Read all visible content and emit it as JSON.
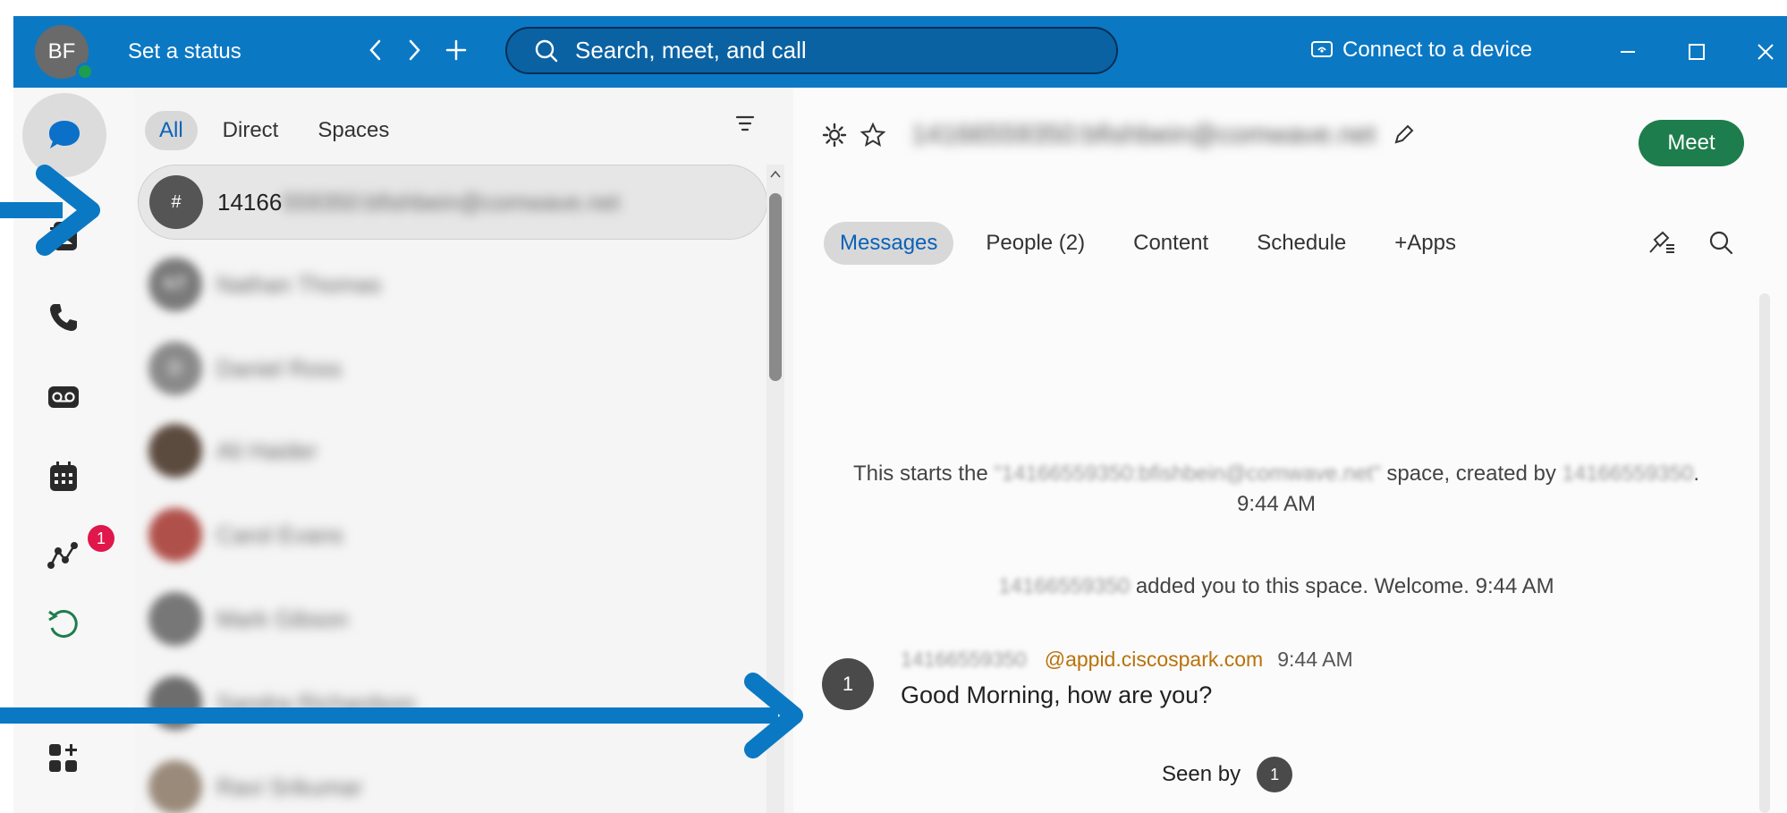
{
  "topbar": {
    "avatar_initials": "BF",
    "status_label": "Set a status",
    "search_placeholder": "Search, meet, and call",
    "connect_label": "Connect to a device",
    "accent": "#0b78c4"
  },
  "rail": {
    "notifications_badge": "1"
  },
  "list": {
    "filters": [
      "All",
      "Direct",
      "Spaces"
    ],
    "active_filter": "All",
    "selected_conversation": {
      "avatar": "#",
      "name_visible": "14166",
      "name_blurred": "559350:bfishbein@comwave.net"
    },
    "conversations": [
      {
        "avatar": "NT",
        "name": "Nathan Thomas"
      },
      {
        "avatar": "D",
        "name": "Daniel Ross"
      },
      {
        "avatar": "",
        "name": "Ali Haider"
      },
      {
        "avatar": "",
        "name": "Carol Evans"
      },
      {
        "avatar": "",
        "name": "Mark Gibson"
      },
      {
        "avatar": "",
        "name": "Sandra Richardson"
      },
      {
        "avatar": "",
        "name": "Ravi Srikumar"
      }
    ]
  },
  "main": {
    "space_title": "14166559350:bfishbein@comwave.net",
    "meet_label": "Meet",
    "tabs": [
      "Messages",
      "People (2)",
      "Content",
      "Schedule",
      "+Apps"
    ],
    "active_tab": "Messages",
    "space_start": {
      "prefix": "This starts the ",
      "space_name": "\"14166559350:bfishbein@comwave.net\"",
      "middle": " space, created by ",
      "creator": "14166559350",
      "suffix": ".",
      "time": "9:44 AM"
    },
    "added_line": {
      "who": "14166559350",
      "text": " added you to this space. Welcome. 9:44 AM"
    },
    "message": {
      "avatar": "1",
      "sender": "14166559350",
      "app": "@appid.ciscospark.com",
      "time": "9:44 AM",
      "body": "Good Morning, how are you?"
    },
    "seen_by": {
      "label": "Seen by",
      "avatar": "1"
    }
  }
}
